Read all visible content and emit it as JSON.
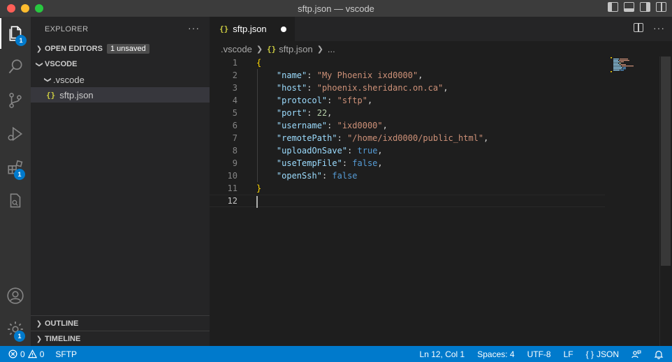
{
  "window": {
    "title": "sftp.json — vscode"
  },
  "activity_bar": {
    "explorer_badge": "1",
    "extensions_badge": "1",
    "settings_badge": "1"
  },
  "sidebar": {
    "header": "EXPLORER",
    "open_editors_label": "OPEN EDITORS",
    "unsaved_badge": "1 unsaved",
    "folder_label": "VSCODE",
    "subfolder_label": ".vscode",
    "file_label": "sftp.json",
    "outline_label": "OUTLINE",
    "timeline_label": "TIMELINE"
  },
  "tabs": [
    {
      "label": "sftp.json",
      "icon": "{}",
      "dirty": true
    }
  ],
  "breadcrumb": {
    "folder": ".vscode",
    "file": "sftp.json",
    "more": "..."
  },
  "editor": {
    "current_line": 12,
    "lines": [
      {
        "n": "1"
      },
      {
        "n": "2"
      },
      {
        "n": "3"
      },
      {
        "n": "4"
      },
      {
        "n": "5"
      },
      {
        "n": "6"
      },
      {
        "n": "7"
      },
      {
        "n": "8"
      },
      {
        "n": "9"
      },
      {
        "n": "10"
      },
      {
        "n": "11"
      },
      {
        "n": "12"
      }
    ],
    "json": {
      "open_brace": "{",
      "close_brace": "}",
      "name_key": "\"name\"",
      "name_val": "\"My Phoenix ixd0000\"",
      "host_key": "\"host\"",
      "host_val": "\"phoenix.sheridanc.on.ca\"",
      "protocol_key": "\"protocol\"",
      "protocol_val": "\"sftp\"",
      "port_key": "\"port\"",
      "port_val": "22",
      "username_key": "\"username\"",
      "username_val": "\"ixd0000\"",
      "remotePath_key": "\"remotePath\"",
      "remotePath_val": "\"/home/ixd0000/public_html\"",
      "uploadOnSave_key": "\"uploadOnSave\"",
      "uploadOnSave_val": "true",
      "useTempFile_key": "\"useTempFile\"",
      "useTempFile_val": "false",
      "openSsh_key": "\"openSsh\"",
      "openSsh_val": "false"
    }
  },
  "statusbar": {
    "errors": "0",
    "warnings": "0",
    "sftp": "SFTP",
    "position": "Ln 12, Col 1",
    "spaces": "Spaces: 4",
    "encoding": "UTF-8",
    "eol": "LF",
    "language": "JSON",
    "language_icon": "{ }"
  },
  "colors": {
    "accent": "#007acc",
    "json_key": "#9cdcfe",
    "json_string": "#ce9178",
    "json_number": "#b5cea8",
    "json_bool": "#569cd6",
    "bracket": "#ffd700"
  }
}
